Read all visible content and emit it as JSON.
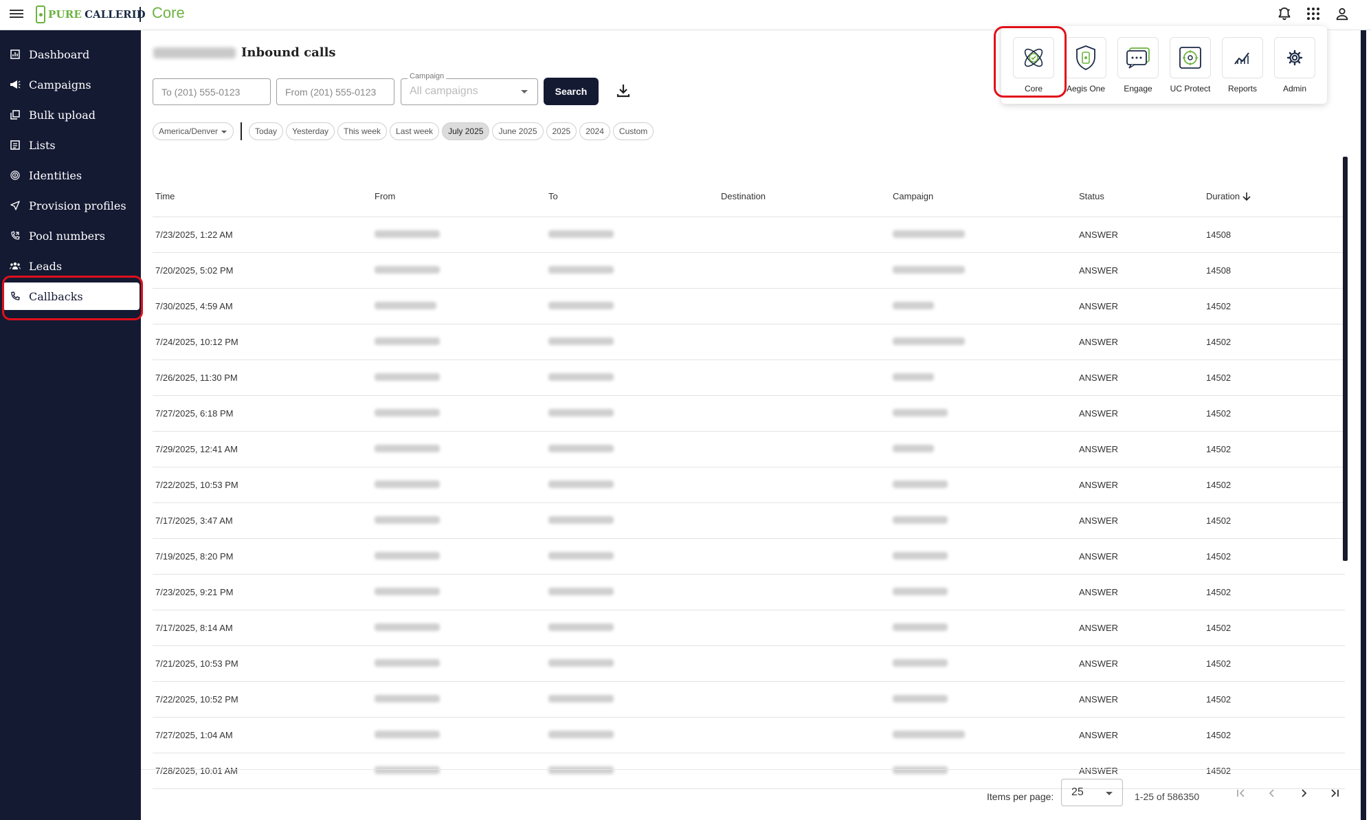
{
  "header": {
    "logo_part1": "PURE",
    "logo_part2": "CALLERID",
    "app_name": "Core"
  },
  "sidebar": {
    "items": [
      {
        "label": "Dashboard",
        "icon": "dashboard-icon"
      },
      {
        "label": "Campaigns",
        "icon": "megaphone-icon"
      },
      {
        "label": "Bulk upload",
        "icon": "bulk-upload-icon"
      },
      {
        "label": "Lists",
        "icon": "list-icon"
      },
      {
        "label": "Identities",
        "icon": "fingerprint-icon"
      },
      {
        "label": "Provision profiles",
        "icon": "send-icon"
      },
      {
        "label": "Pool numbers",
        "icon": "phone-forward-icon"
      },
      {
        "label": "Leads",
        "icon": "people-icon"
      },
      {
        "label": "Callbacks",
        "icon": "phone-icon"
      }
    ],
    "active": "Callbacks"
  },
  "page": {
    "title": "Inbound calls"
  },
  "filters": {
    "to_placeholder": "To (201) 555-0123",
    "from_placeholder": "From (201) 555-0123",
    "campaign_label": "Campaign",
    "campaign_value": "All campaigns",
    "search_label": "Search",
    "timezone": "America/Denver",
    "date_chips": [
      "Today",
      "Yesterday",
      "This week",
      "Last week",
      "July 2025",
      "June 2025",
      "2025",
      "2024",
      "Custom"
    ],
    "selected_chip": "July 2025"
  },
  "table": {
    "headers": {
      "time": "Time",
      "from": "From",
      "to": "To",
      "destination": "Destination",
      "campaign": "Campaign",
      "status": "Status",
      "duration": "Duration"
    },
    "rows": [
      {
        "time": "7/23/2025, 1:22 AM",
        "status": "ANSWER",
        "duration": "14508"
      },
      {
        "time": "7/20/2025, 5:02 PM",
        "status": "ANSWER",
        "duration": "14508"
      },
      {
        "time": "7/30/2025, 4:59 AM",
        "status": "ANSWER",
        "duration": "14502"
      },
      {
        "time": "7/24/2025, 10:12 PM",
        "status": "ANSWER",
        "duration": "14502"
      },
      {
        "time": "7/26/2025, 11:30 PM",
        "status": "ANSWER",
        "duration": "14502"
      },
      {
        "time": "7/27/2025, 6:18 PM",
        "status": "ANSWER",
        "duration": "14502"
      },
      {
        "time": "7/29/2025, 12:41 AM",
        "status": "ANSWER",
        "duration": "14502"
      },
      {
        "time": "7/22/2025, 10:53 PM",
        "status": "ANSWER",
        "duration": "14502"
      },
      {
        "time": "7/17/2025, 3:47 AM",
        "status": "ANSWER",
        "duration": "14502"
      },
      {
        "time": "7/19/2025, 8:20 PM",
        "status": "ANSWER",
        "duration": "14502"
      },
      {
        "time": "7/23/2025, 9:21 PM",
        "status": "ANSWER",
        "duration": "14502"
      },
      {
        "time": "7/17/2025, 8:14 AM",
        "status": "ANSWER",
        "duration": "14502"
      },
      {
        "time": "7/21/2025, 10:53 PM",
        "status": "ANSWER",
        "duration": "14502"
      },
      {
        "time": "7/22/2025, 10:52 PM",
        "status": "ANSWER",
        "duration": "14502"
      },
      {
        "time": "7/27/2025, 1:04 AM",
        "status": "ANSWER",
        "duration": "14502"
      },
      {
        "time": "7/28/2025, 10:01 AM",
        "status": "ANSWER",
        "duration": "14502"
      }
    ]
  },
  "pagination": {
    "items_per_page_label": "Items per page:",
    "items_per_page": "25",
    "range": "1-25 of 586350"
  },
  "app_switcher": {
    "apps": [
      {
        "label": "Core",
        "icon": "core-atom-icon"
      },
      {
        "label": "Aegis One",
        "icon": "shield-icon"
      },
      {
        "label": "Engage",
        "icon": "chat-icon"
      },
      {
        "label": "UC Protect",
        "icon": "safe-icon"
      },
      {
        "label": "Reports",
        "icon": "chart-icon"
      },
      {
        "label": "Admin",
        "icon": "gear-icon"
      }
    ]
  },
  "colors": {
    "sidebar_bg": "#151a33",
    "brand_green": "#6cb33f",
    "highlight_red": "#e0101a"
  }
}
